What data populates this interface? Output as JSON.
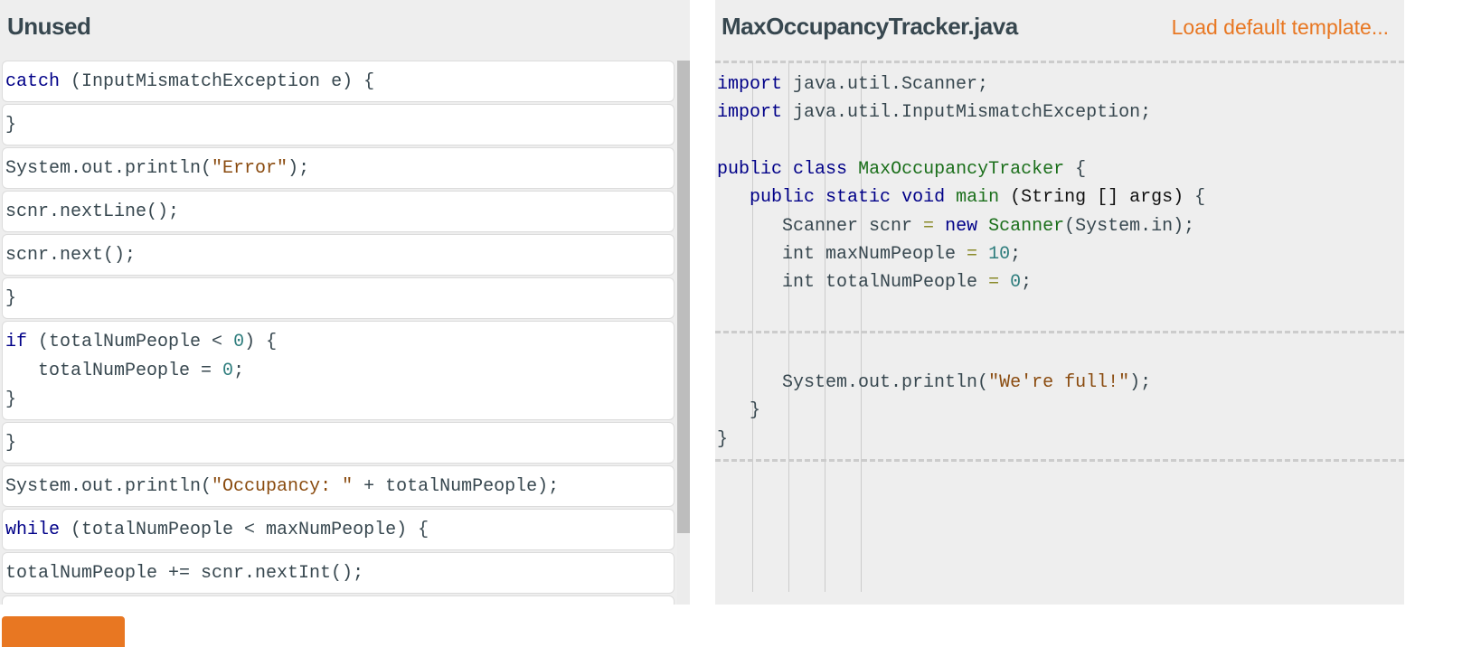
{
  "unused": {
    "title": "Unused",
    "blocks": [
      {
        "lines": [
          [
            {
              "t": "catch",
              "c": "kw"
            },
            {
              "t": " (InputMismatchException e) {",
              "c": ""
            }
          ]
        ]
      },
      {
        "lines": [
          [
            {
              "t": "}",
              "c": ""
            }
          ]
        ]
      },
      {
        "lines": [
          [
            {
              "t": "System.out.println(",
              "c": ""
            },
            {
              "t": "\"Error\"",
              "c": "str"
            },
            {
              "t": ");",
              "c": ""
            }
          ]
        ]
      },
      {
        "lines": [
          [
            {
              "t": "scnr.nextLine();",
              "c": ""
            }
          ]
        ]
      },
      {
        "lines": [
          [
            {
              "t": "scnr.next();",
              "c": ""
            }
          ]
        ]
      },
      {
        "lines": [
          [
            {
              "t": "}",
              "c": ""
            }
          ]
        ]
      },
      {
        "lines": [
          [
            {
              "t": "if",
              "c": "kw"
            },
            {
              "t": " (totalNumPeople < ",
              "c": ""
            },
            {
              "t": "0",
              "c": "num"
            },
            {
              "t": ") {",
              "c": ""
            }
          ],
          [
            {
              "t": "   totalNumPeople = ",
              "c": ""
            },
            {
              "t": "0",
              "c": "num"
            },
            {
              "t": ";",
              "c": ""
            }
          ],
          [
            {
              "t": "}",
              "c": ""
            }
          ]
        ]
      },
      {
        "lines": [
          [
            {
              "t": "}",
              "c": ""
            }
          ]
        ]
      },
      {
        "lines": [
          [
            {
              "t": "System.out.println(",
              "c": ""
            },
            {
              "t": "\"Occupancy: \"",
              "c": "str"
            },
            {
              "t": " + totalNumPeople);",
              "c": ""
            }
          ]
        ]
      },
      {
        "lines": [
          [
            {
              "t": "while",
              "c": "kw"
            },
            {
              "t": " (totalNumPeople < maxNumPeople) {",
              "c": ""
            }
          ]
        ]
      },
      {
        "lines": [
          [
            {
              "t": "totalNumPeople += scnr.nextInt();",
              "c": ""
            }
          ]
        ]
      },
      {
        "lines": [
          [
            {
              "t": "",
              "c": ""
            }
          ]
        ]
      }
    ]
  },
  "editor": {
    "filename": "MaxOccupancyTracker.java",
    "load_template_label": "Load default template...",
    "lines": [
      [
        {
          "t": "import",
          "c": "kw"
        },
        {
          "t": " java.util.Scanner;",
          "c": ""
        }
      ],
      [
        {
          "t": "import",
          "c": "kw"
        },
        {
          "t": " java.util.InputMismatchException;",
          "c": ""
        }
      ],
      [
        {
          "t": "",
          "c": ""
        }
      ],
      [
        {
          "t": "public",
          "c": "kw"
        },
        {
          "t": " ",
          "c": ""
        },
        {
          "t": "class",
          "c": "kw"
        },
        {
          "t": " ",
          "c": ""
        },
        {
          "t": "MaxOccupancyTracker",
          "c": "ty"
        },
        {
          "t": " {",
          "c": ""
        }
      ],
      [
        {
          "t": "   ",
          "c": ""
        },
        {
          "t": "public",
          "c": "kw"
        },
        {
          "t": " ",
          "c": ""
        },
        {
          "t": "static",
          "c": "kw"
        },
        {
          "t": " ",
          "c": ""
        },
        {
          "t": "void",
          "c": "kw"
        },
        {
          "t": " ",
          "c": ""
        },
        {
          "t": "main",
          "c": "ty"
        },
        {
          "t": " (String [] args) ",
          "c": "pl"
        },
        {
          "t": "{",
          "c": ""
        }
      ],
      [
        {
          "t": "      Scanner scnr ",
          "c": ""
        },
        {
          "t": "=",
          "c": "op"
        },
        {
          "t": " ",
          "c": ""
        },
        {
          "t": "new",
          "c": "kw"
        },
        {
          "t": " ",
          "c": ""
        },
        {
          "t": "Scanner",
          "c": "ty"
        },
        {
          "t": "(System.in);",
          "c": ""
        }
      ],
      [
        {
          "t": "      int maxNumPeople ",
          "c": ""
        },
        {
          "t": "=",
          "c": "op"
        },
        {
          "t": " ",
          "c": ""
        },
        {
          "t": "10",
          "c": "num"
        },
        {
          "t": ";",
          "c": ""
        }
      ],
      [
        {
          "t": "      int totalNumPeople ",
          "c": ""
        },
        {
          "t": "=",
          "c": "op"
        },
        {
          "t": " ",
          "c": ""
        },
        {
          "t": "0",
          "c": "num"
        },
        {
          "t": ";",
          "c": ""
        }
      ]
    ],
    "lines_after_drop": [
      [
        {
          "t": "      System.out.println(",
          "c": ""
        },
        {
          "t": "\"We're full!\"",
          "c": "str"
        },
        {
          "t": ");",
          "c": ""
        }
      ],
      [
        {
          "t": "   }",
          "c": ""
        }
      ],
      [
        {
          "t": "}",
          "c": ""
        }
      ]
    ]
  },
  "bottom_button": {
    "label": ""
  }
}
